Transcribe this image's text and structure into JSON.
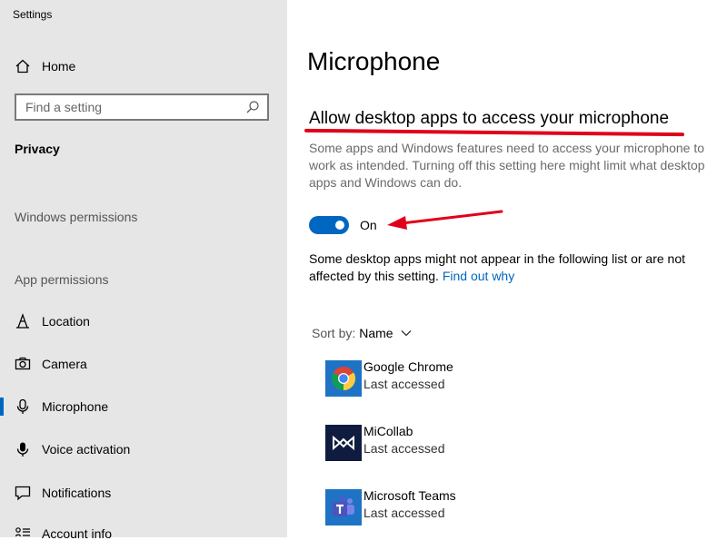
{
  "window": {
    "title": "Settings"
  },
  "sidebar": {
    "home_label": "Home",
    "search_placeholder": "Find a setting",
    "category": "Privacy",
    "windows_permissions": "Windows permissions",
    "app_permissions": "App permissions",
    "items": [
      {
        "label": "Location",
        "icon": "location-icon"
      },
      {
        "label": "Camera",
        "icon": "camera-icon"
      },
      {
        "label": "Microphone",
        "icon": "microphone-icon",
        "active": true
      },
      {
        "label": "Voice activation",
        "icon": "voice-activation-icon"
      },
      {
        "label": "Notifications",
        "icon": "notifications-icon"
      },
      {
        "label": "Account info",
        "icon": "account-info-icon"
      }
    ]
  },
  "main": {
    "title": "Microphone",
    "section_title": "Allow desktop apps to access your microphone",
    "description": "Some apps and Windows features need to access your microphone to work as intended. Turning off this setting here might limit what desktop apps and Windows can do.",
    "toggle_state": "On",
    "note": "Some desktop apps might not appear in the following list or are not affected by this setting.",
    "note_link": "Find out why",
    "sort_label": "Sort by:",
    "sort_value": "Name",
    "apps": [
      {
        "name": "Google Chrome",
        "sub": "Last accessed",
        "icon": "chrome-icon"
      },
      {
        "name": "MiCollab",
        "sub": "Last accessed",
        "icon": "micollab-icon"
      },
      {
        "name": "Microsoft Teams",
        "sub": "Last accessed",
        "icon": "teams-icon"
      }
    ]
  },
  "colors": {
    "accent": "#0067c0",
    "annotation": "#e0001a",
    "sidebar_bg": "#e6e6e6"
  }
}
